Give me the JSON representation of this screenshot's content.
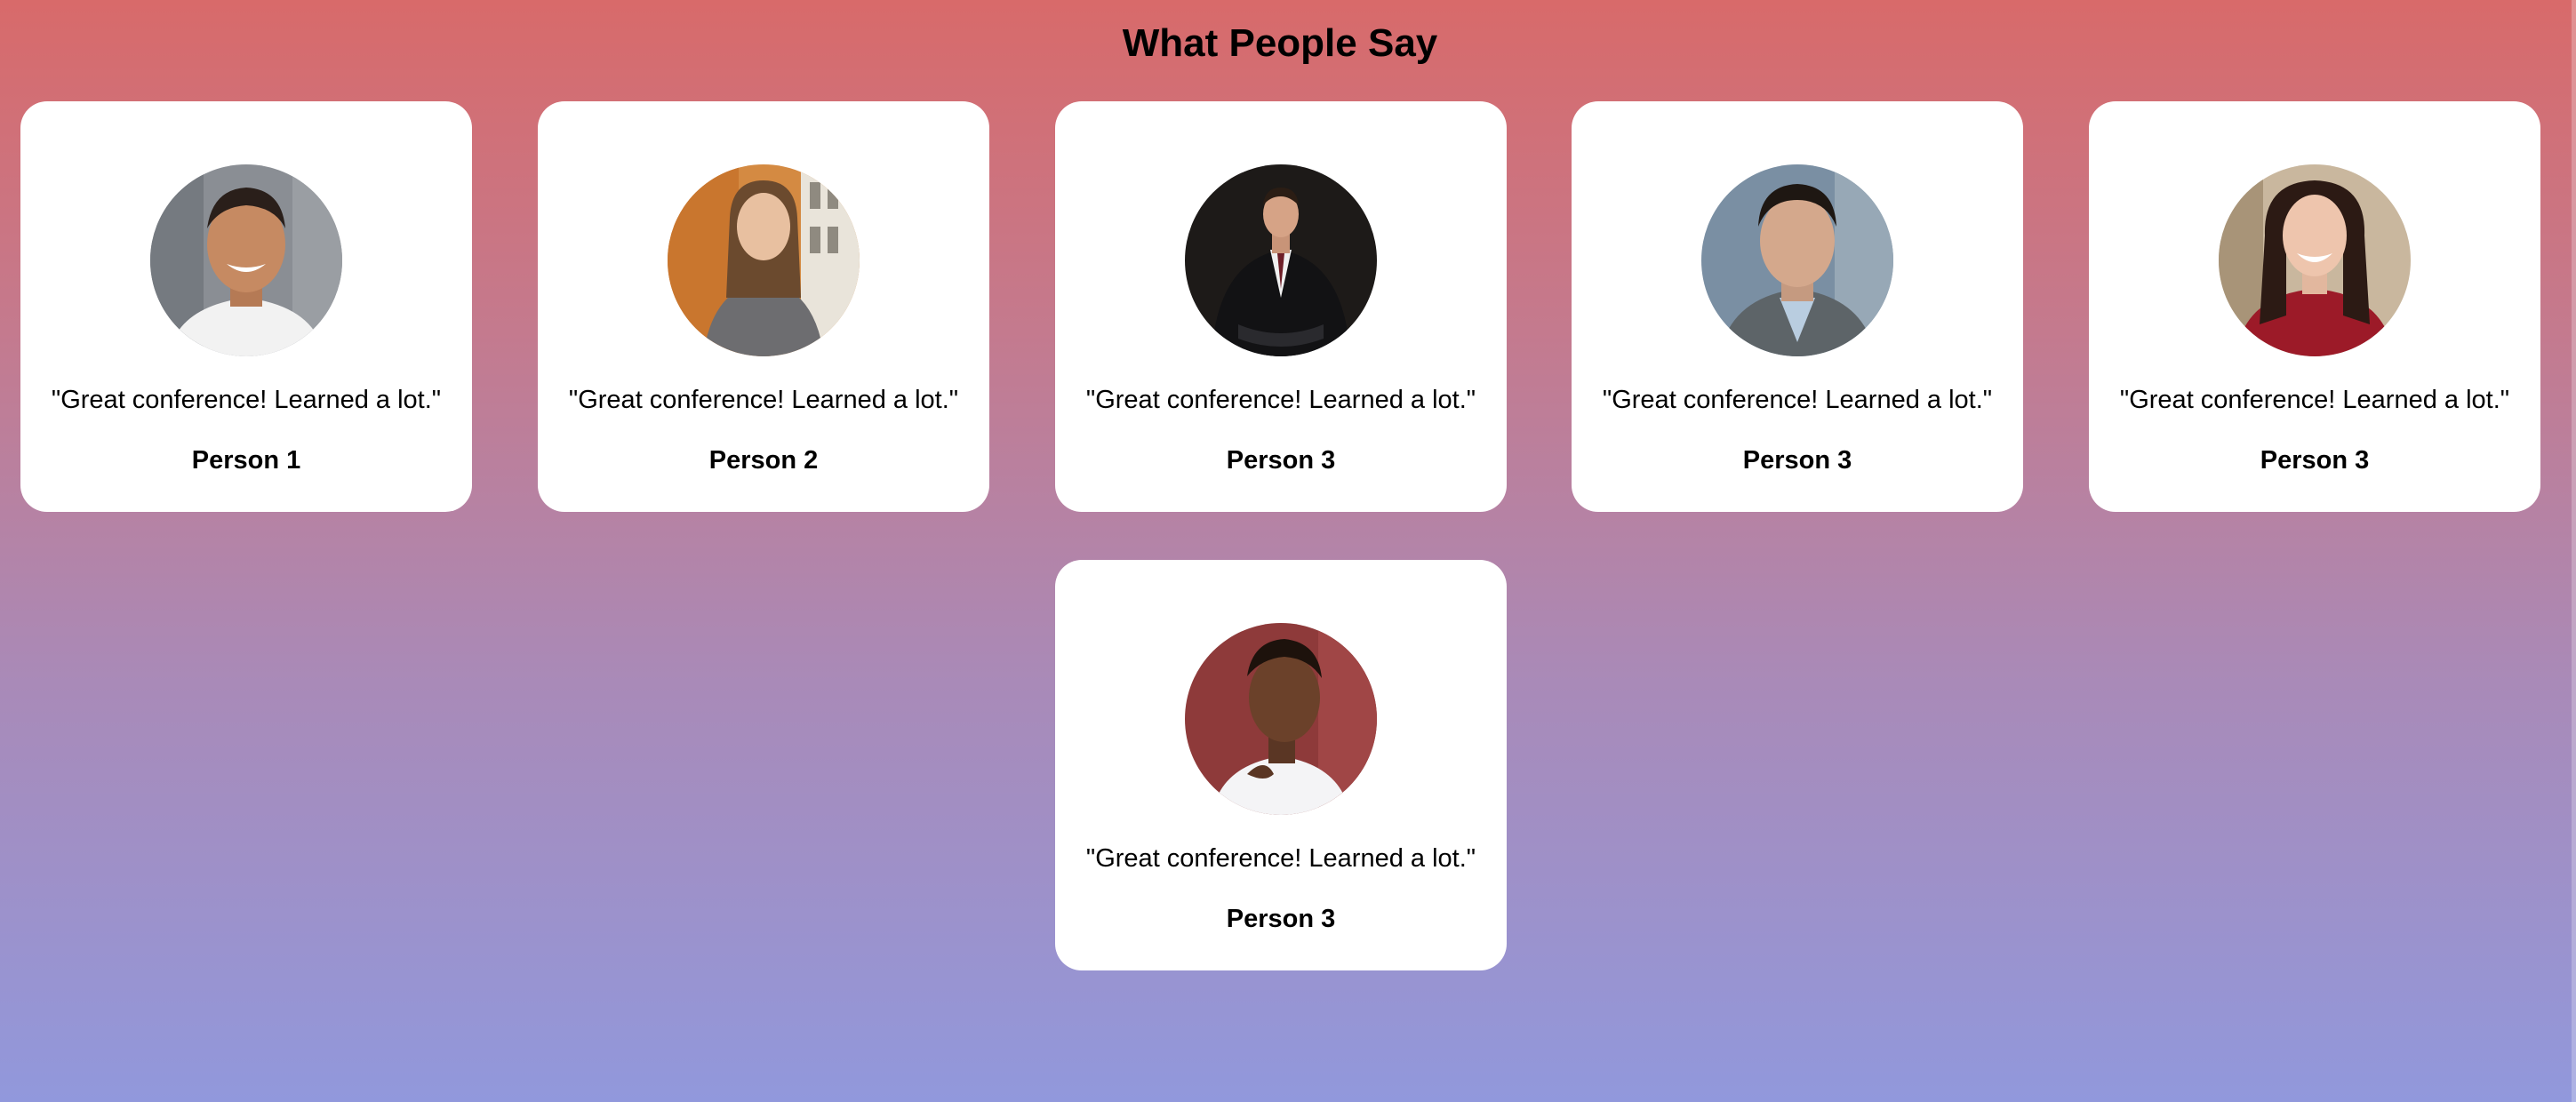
{
  "page": {
    "title": "What People Say"
  },
  "testimonials": [
    {
      "quote": "\"Great conference! Learned a lot.\"",
      "name": "Person 1"
    },
    {
      "quote": "\"Great conference! Learned a lot.\"",
      "name": "Person 2"
    },
    {
      "quote": "\"Great conference! Learned a lot.\"",
      "name": "Person 3"
    },
    {
      "quote": "\"Great conference! Learned a lot.\"",
      "name": "Person 3"
    },
    {
      "quote": "\"Great conference! Learned a lot.\"",
      "name": "Person 3"
    },
    {
      "quote": "\"Great conference! Learned a lot.\"",
      "name": "Person 3"
    }
  ],
  "colors": {
    "background_top": "#d86a6a",
    "background_bottom": "#9198dc",
    "card": "#ffffff",
    "text": "#000000"
  }
}
